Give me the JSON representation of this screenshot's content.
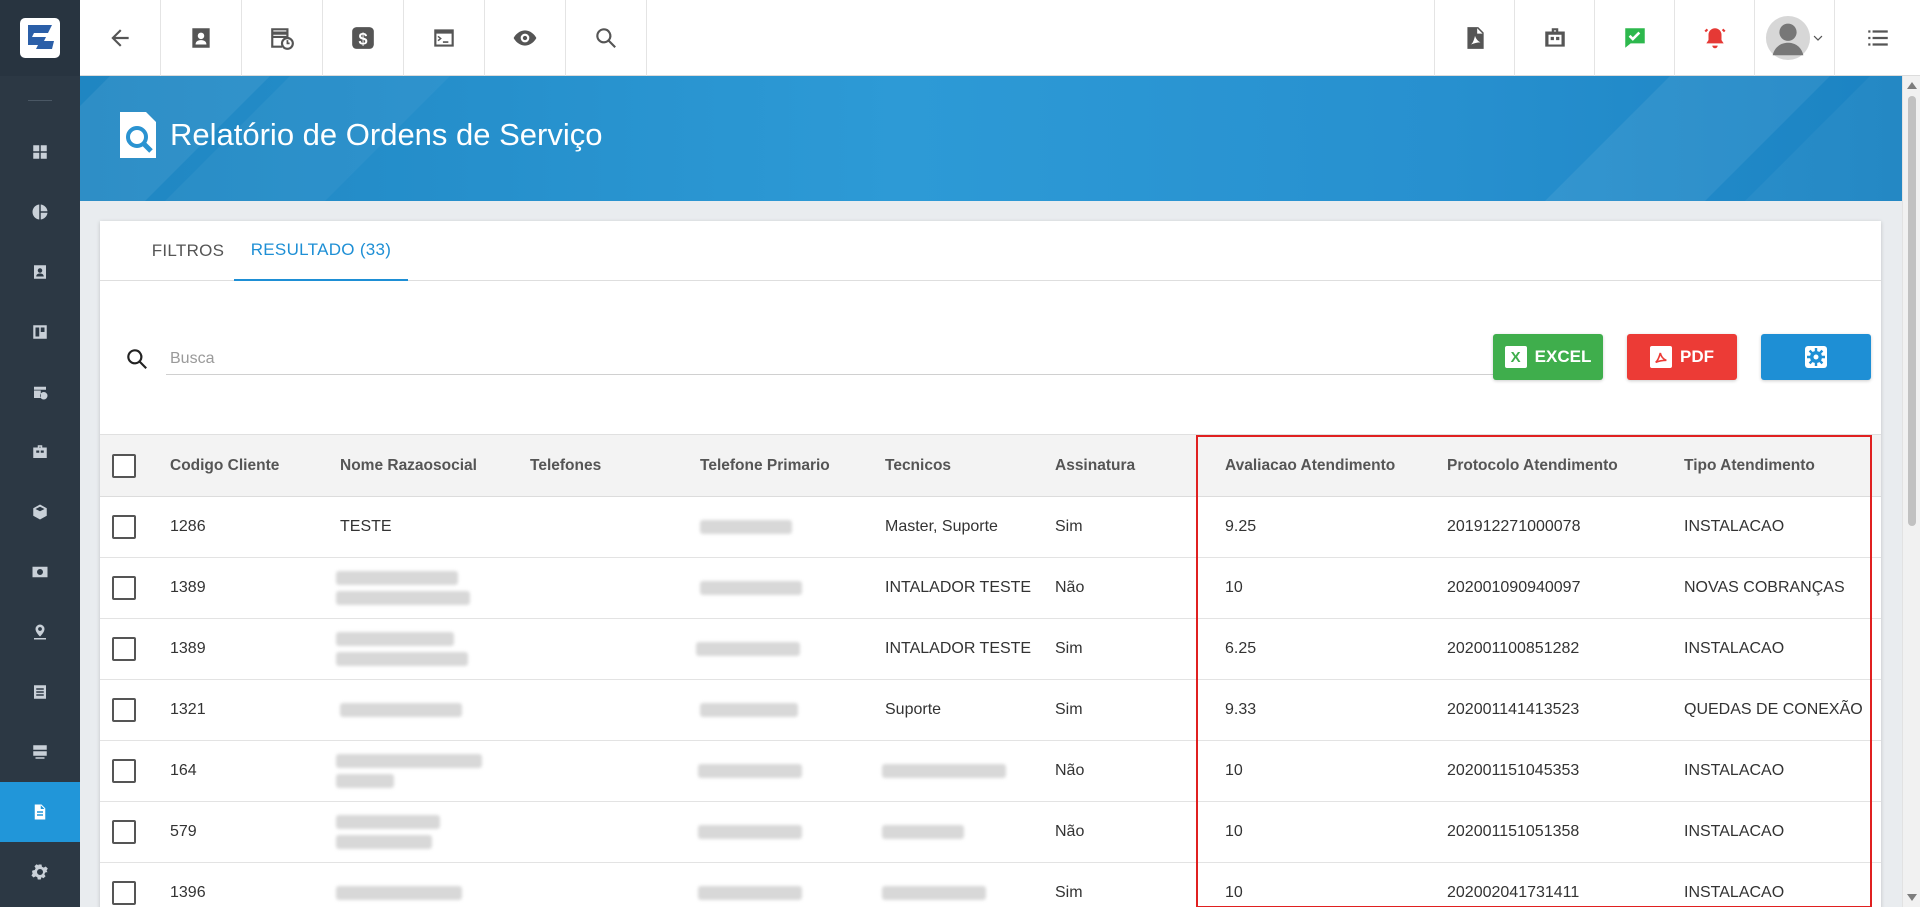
{
  "sidebar": {
    "items": [
      {
        "icon": "dashboard-icon"
      },
      {
        "icon": "pie-chart-icon"
      },
      {
        "icon": "contact-card-icon"
      },
      {
        "icon": "kanban-icon"
      },
      {
        "icon": "calendar-clock-icon"
      },
      {
        "icon": "briefcase-icon"
      },
      {
        "icon": "box-icon"
      },
      {
        "icon": "money-icon"
      },
      {
        "icon": "map-pin-icon"
      },
      {
        "icon": "list-icon"
      },
      {
        "icon": "server-icon"
      },
      {
        "icon": "document-icon",
        "active": true
      },
      {
        "icon": "gear-icon"
      }
    ]
  },
  "header": {
    "title": "Relatório de Ordens de Serviço"
  },
  "tabs": [
    {
      "label": "FILTROS",
      "active": false
    },
    {
      "label": "RESULTADO (33)",
      "active": true
    }
  ],
  "search": {
    "placeholder": "Busca",
    "value": ""
  },
  "buttons": {
    "excel_label": "EXCEL",
    "excel_glyph": "X",
    "pdf_label": "PDF"
  },
  "table": {
    "headers": [
      "Codigo Cliente",
      "Nome Razaosocial",
      "Telefones",
      "Telefone Primario",
      "Tecnicos",
      "Assinatura",
      "Avaliacao Atendimento",
      "Protocolo Atendimento",
      "Tipo Atendimento"
    ],
    "rows": [
      {
        "codigo": "1286",
        "nome": "TESTE",
        "tecnicos": "Master, Suporte",
        "assinatura": "Sim",
        "avaliacao": "9.25",
        "protocolo": "201912271000078",
        "tipo": "INSTALACAO"
      },
      {
        "codigo": "1389",
        "nome": "",
        "tecnicos": "INTALADOR TESTE",
        "assinatura": "Não",
        "avaliacao": "10",
        "protocolo": "202001090940097",
        "tipo": "NOVAS COBRANÇAS"
      },
      {
        "codigo": "1389",
        "nome": "",
        "tecnicos": "INTALADOR TESTE",
        "assinatura": "Sim",
        "avaliacao": "6.25",
        "protocolo": "202001100851282",
        "tipo": "INSTALACAO"
      },
      {
        "codigo": "1321",
        "nome": "",
        "tecnicos": "Suporte",
        "assinatura": "Sim",
        "avaliacao": "9.33",
        "protocolo": "202001141413523",
        "tipo": "QUEDAS DE CONEXÃO"
      },
      {
        "codigo": "164",
        "nome": "",
        "tecnicos": "",
        "assinatura": "Não",
        "avaliacao": "10",
        "protocolo": "202001151045353",
        "tipo": "INSTALACAO"
      },
      {
        "codigo": "579",
        "nome": "",
        "tecnicos": "",
        "assinatura": "Não",
        "avaliacao": "10",
        "protocolo": "202001151051358",
        "tipo": "INSTALACAO"
      },
      {
        "codigo": "1396",
        "nome": "",
        "tecnicos": "",
        "assinatura": "Sim",
        "avaliacao": "10",
        "protocolo": "202002041731411",
        "tipo": "INSTALACAO"
      }
    ]
  },
  "colors": {
    "accent": "#1e8fd5",
    "sidebar_bg": "#2c3844",
    "excel_green": "#3fae4c",
    "pdf_red": "#ec3b36",
    "highlight_red": "#e02020",
    "status_green": "#2db84d",
    "alert_red": "#e53935"
  }
}
